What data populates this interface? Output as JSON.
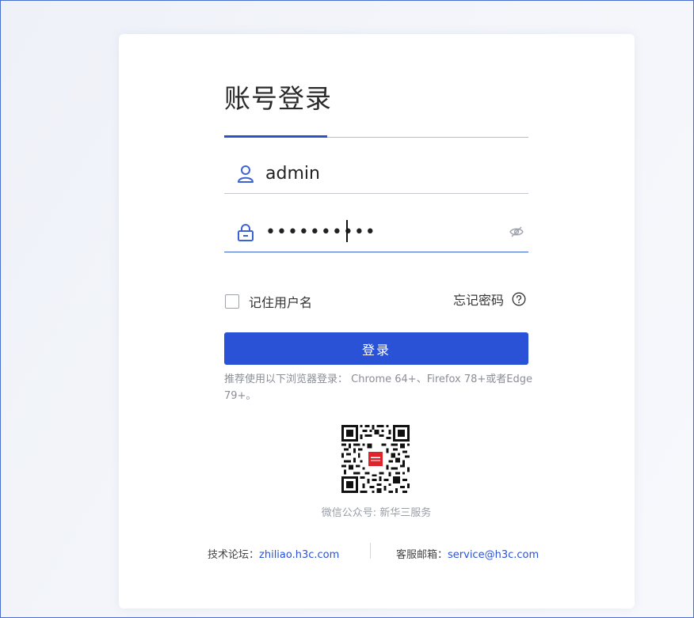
{
  "login": {
    "title": "账号登录",
    "username_value": "admin",
    "password_value": "••••••••••",
    "remember_label": "记住用户名",
    "forgot_label": "忘记密码",
    "login_button": "登录",
    "browser_tip": "推荐使用以下浏览器登录： Chrome 64+、Firefox 78+或者Edge 79+。",
    "qr_caption": "微信公众号: 新华三服务"
  },
  "footer": {
    "forum_label": "技术论坛：",
    "forum_link": "zhiliao.h3c.com",
    "email_label": "客服邮箱：",
    "email_link": "service@h3c.com"
  },
  "colors": {
    "accent": "#2a52d6",
    "frame_border": "#4a6fcf"
  },
  "icons": {
    "username": "user-icon",
    "password": "lock-icon",
    "toggle_visibility": "eye-off-icon",
    "help": "question-circle-icon",
    "qr": "qr-code-icon"
  }
}
